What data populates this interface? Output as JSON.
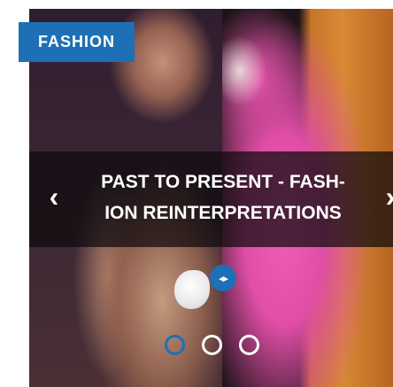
{
  "category": {
    "label": "FASHION"
  },
  "slide": {
    "title": "PAST TO PRESENT - FASH-ION REINTERPRETATIONS"
  },
  "navigation": {
    "prev_icon": "chevron-left-icon",
    "next_icon": "chevron-right-icon",
    "prev_glyph": "‹",
    "next_glyph": "›"
  },
  "compare_handle": {
    "icon": "left-right-arrows-icon",
    "glyph": "◂▸"
  },
  "pagination": {
    "count": 3,
    "active_index": 0
  },
  "colors": {
    "accent": "#1d70b6",
    "caption_overlay": "rgba(12,10,12,0.72)",
    "text": "#ffffff"
  }
}
